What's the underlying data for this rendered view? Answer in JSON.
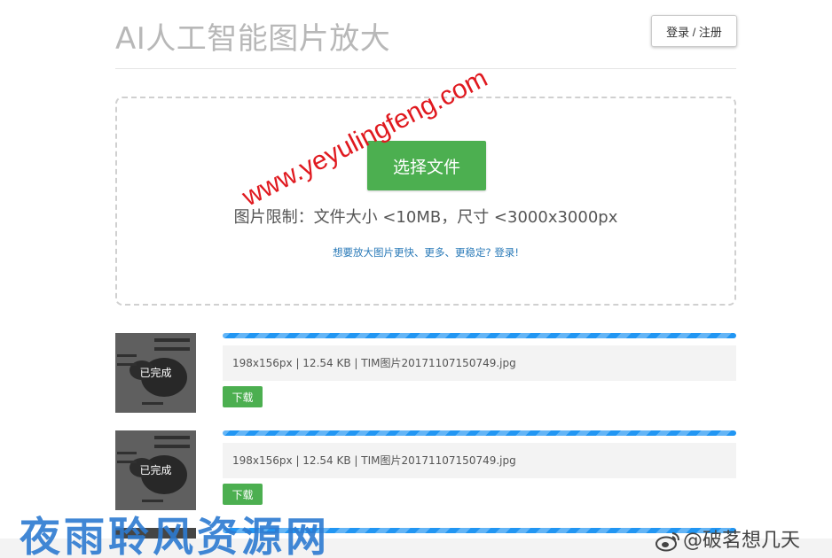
{
  "header": {
    "title": "AI人工智能图片放大",
    "login_label": "登录 / 注册"
  },
  "upload": {
    "select_label": "选择文件",
    "limit_text": "图片限制：文件大小 <10MB，尺寸 <3000x3000px",
    "login_hint": "想要放大图片更快、更多、更稳定? 登录!"
  },
  "jobs": [
    {
      "status": "已完成",
      "info": "198x156px | 12.54 KB | TIM图片20171107150749.jpg",
      "download_label": "下载",
      "progress": 1.0
    },
    {
      "status": "已完成",
      "info": "198x156px | 12.54 KB | TIM图片20171107150749.jpg",
      "download_label": "下载",
      "progress": 1.0
    }
  ],
  "watermarks": {
    "url": "www.yeyulingfeng.com",
    "site_name": "夜雨聆风资源网",
    "weibo": "@破茗想几天"
  },
  "colors": {
    "primary_green": "#4caf50",
    "progress_blue": "#2196f3",
    "link_blue": "#2a7ab8",
    "title_gray": "#b8b8b8",
    "watermark_red": "#e0191f"
  }
}
